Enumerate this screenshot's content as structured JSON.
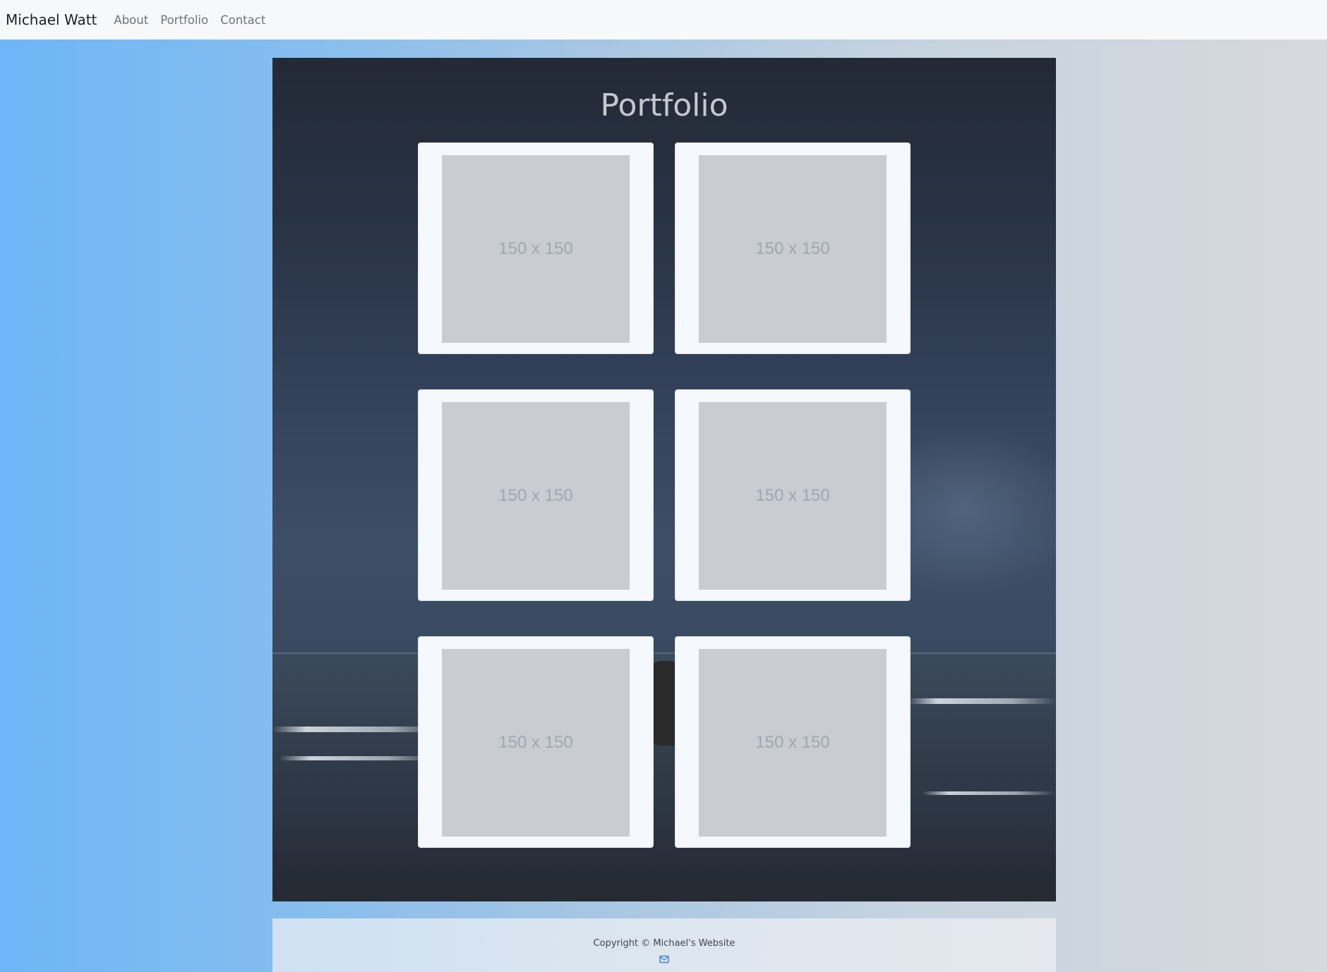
{
  "navbar": {
    "brand": "Michael Watt",
    "links": [
      {
        "label": "About"
      },
      {
        "label": "Portfolio"
      },
      {
        "label": "Contact"
      }
    ]
  },
  "portfolio": {
    "title": "Portfolio",
    "items": [
      {
        "placeholder": "150 x 150"
      },
      {
        "placeholder": "150 x 150"
      },
      {
        "placeholder": "150 x 150"
      },
      {
        "placeholder": "150 x 150"
      },
      {
        "placeholder": "150 x 150"
      },
      {
        "placeholder": "150 x 150"
      }
    ]
  },
  "footer": {
    "copyright": "Copyright © Michael's Website",
    "icon": "envelope-icon"
  },
  "colors": {
    "navbar_bg": "#f7f8fa",
    "card_bg": "#f5f8fc",
    "placeholder_bg": "#c9cdd1",
    "accent_icon": "#3f7fd6"
  }
}
